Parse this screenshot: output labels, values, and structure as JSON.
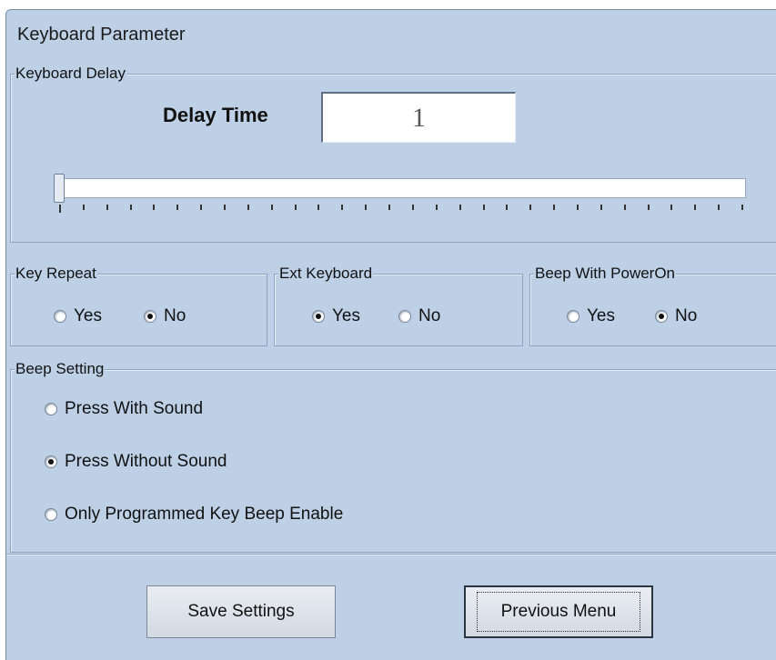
{
  "window": {
    "title": "Keyboard Parameter"
  },
  "keyboard_delay": {
    "group_label": "Keyboard Delay",
    "delay_time_label": "Delay Time",
    "delay_time_value": "1",
    "slider": {
      "value": 1,
      "min": 1,
      "max": 30
    }
  },
  "key_repeat": {
    "group_label": "Key Repeat",
    "options": [
      {
        "label": "Yes",
        "selected": false
      },
      {
        "label": "No",
        "selected": true
      }
    ]
  },
  "ext_keyboard": {
    "group_label": "Ext Keyboard",
    "options": [
      {
        "label": "Yes",
        "selected": true
      },
      {
        "label": "No",
        "selected": false
      }
    ]
  },
  "beep_power_on": {
    "group_label": "Beep With PowerOn",
    "options": [
      {
        "label": "Yes",
        "selected": false
      },
      {
        "label": "No",
        "selected": true
      }
    ]
  },
  "beep_setting": {
    "group_label": "Beep Setting",
    "options": [
      {
        "label": "Press With Sound",
        "selected": false
      },
      {
        "label": "Press Without Sound",
        "selected": true
      },
      {
        "label": "Only Programmed Key Beep Enable",
        "selected": false
      }
    ]
  },
  "buttons": {
    "save_label": "Save Settings",
    "previous_label": "Previous Menu"
  },
  "colors": {
    "background": "#bdd0e6",
    "group_border": "#8ea3bf"
  }
}
